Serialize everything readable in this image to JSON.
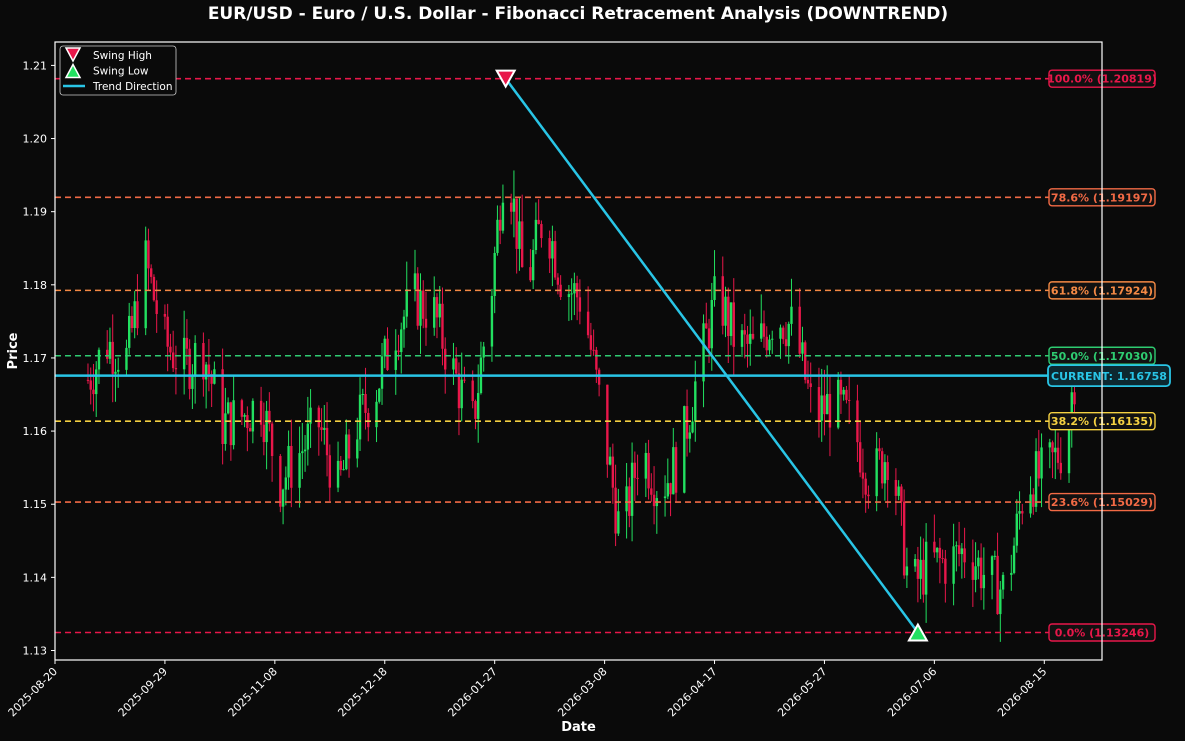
{
  "chart_data": {
    "type": "candlestick",
    "title": "EUR/USD - Euro / U.S. Dollar - Fibonacci Retracement Analysis (DOWNTREND)",
    "xlabel": "Date",
    "ylabel": "Price",
    "ylim": [
      1.1287,
      1.2132
    ],
    "xlim": [
      "2025-08-20",
      "2026-09-05"
    ],
    "x_ticks": [
      "2025-08-20",
      "2025-09-29",
      "2025-11-08",
      "2025-12-18",
      "2026-01-27",
      "2026-03-08",
      "2026-04-17",
      "2026-05-27",
      "2026-07-06",
      "2026-08-15"
    ],
    "y_ticks": [
      "1.13",
      "1.14",
      "1.15",
      "1.16",
      "1.17",
      "1.18",
      "1.19",
      "1.20",
      "1.21"
    ],
    "grid": false,
    "legend": {
      "placement": "top-left",
      "entries": [
        {
          "name": "Swing High",
          "marker": "down-triangle",
          "color": "#e8174a"
        },
        {
          "name": "Swing Low",
          "marker": "up-triangle",
          "color": "#22e060"
        },
        {
          "name": "Trend Direction",
          "marker": "line",
          "color": "#29c5e6"
        }
      ]
    },
    "fib_levels": [
      {
        "label": "100.0% (1.20819)",
        "price": 1.20819,
        "color": "#e8174a"
      },
      {
        "label": "78.6% (1.19197)",
        "price": 1.19197,
        "color": "#f26a45"
      },
      {
        "label": "61.8% (1.17924)",
        "price": 1.17924,
        "color": "#f58a45"
      },
      {
        "label": "50.0% (1.17030)",
        "price": 1.1703,
        "color": "#2ecc71"
      },
      {
        "label": "38.2% (1.16135)",
        "price": 1.16135,
        "color": "#f5d142"
      },
      {
        "label": "23.6% (1.15029)",
        "price": 1.15029,
        "color": "#f26a45"
      },
      {
        "label": "0.0% (1.13246)",
        "price": 1.13246,
        "color": "#e8174a"
      }
    ],
    "current": {
      "label": "CURRENT: 1.16758",
      "price": 1.16758,
      "color": "#29c5e6"
    },
    "swing_high": {
      "date": "2026-01-31",
      "price": 1.20819
    },
    "swing_low": {
      "date": "2026-06-30",
      "price": 1.13246
    },
    "trend_line": {
      "from": {
        "date": "2026-01-31",
        "price": 1.20819
      },
      "to": {
        "date": "2026-06-30",
        "price": 1.13246
      }
    },
    "candle_colors": {
      "up": "#22e060",
      "down": "#e8174a"
    },
    "price_path": [
      {
        "date": "2025-09-01",
        "price": 1.167
      },
      {
        "date": "2025-09-08",
        "price": 1.172
      },
      {
        "date": "2025-09-15",
        "price": 1.17
      },
      {
        "date": "2025-09-22",
        "price": 1.183
      },
      {
        "date": "2025-09-29",
        "price": 1.172
      },
      {
        "date": "2025-10-06",
        "price": 1.169
      },
      {
        "date": "2025-10-13",
        "price": 1.171
      },
      {
        "date": "2025-10-20",
        "price": 1.161
      },
      {
        "date": "2025-10-27",
        "price": 1.162
      },
      {
        "date": "2025-11-03",
        "price": 1.164
      },
      {
        "date": "2025-11-10",
        "price": 1.153
      },
      {
        "date": "2025-11-17",
        "price": 1.157
      },
      {
        "date": "2025-11-24",
        "price": 1.161
      },
      {
        "date": "2025-12-01",
        "price": 1.152
      },
      {
        "date": "2025-12-08",
        "price": 1.161
      },
      {
        "date": "2025-12-15",
        "price": 1.166
      },
      {
        "date": "2025-12-22",
        "price": 1.174
      },
      {
        "date": "2025-12-29",
        "price": 1.178
      },
      {
        "date": "2026-01-05",
        "price": 1.176
      },
      {
        "date": "2026-01-12",
        "price": 1.168
      },
      {
        "date": "2026-01-19",
        "price": 1.161
      },
      {
        "date": "2026-01-26",
        "price": 1.18
      },
      {
        "date": "2026-01-31",
        "price": 1.199
      },
      {
        "date": "2026-02-07",
        "price": 1.179
      },
      {
        "date": "2026-02-14",
        "price": 1.19
      },
      {
        "date": "2026-02-21",
        "price": 1.18
      },
      {
        "date": "2026-02-28",
        "price": 1.178
      },
      {
        "date": "2026-03-07",
        "price": 1.162
      },
      {
        "date": "2026-03-14",
        "price": 1.145
      },
      {
        "date": "2026-03-21",
        "price": 1.158
      },
      {
        "date": "2026-03-28",
        "price": 1.152
      },
      {
        "date": "2026-04-04",
        "price": 1.156
      },
      {
        "date": "2026-04-11",
        "price": 1.168
      },
      {
        "date": "2026-04-18",
        "price": 1.179
      },
      {
        "date": "2026-04-25",
        "price": 1.172
      },
      {
        "date": "2026-05-02",
        "price": 1.171
      },
      {
        "date": "2026-05-09",
        "price": 1.176
      },
      {
        "date": "2026-05-16",
        "price": 1.174
      },
      {
        "date": "2026-05-23",
        "price": 1.162
      },
      {
        "date": "2026-05-30",
        "price": 1.164
      },
      {
        "date": "2026-06-06",
        "price": 1.161
      },
      {
        "date": "2026-06-13",
        "price": 1.153
      },
      {
        "date": "2026-06-20",
        "price": 1.158
      },
      {
        "date": "2026-06-27",
        "price": 1.138
      },
      {
        "date": "2026-07-04",
        "price": 1.142
      },
      {
        "date": "2026-07-11",
        "price": 1.142
      },
      {
        "date": "2026-07-18",
        "price": 1.144
      },
      {
        "date": "2026-07-25",
        "price": 1.14
      },
      {
        "date": "2026-08-01",
        "price": 1.138
      },
      {
        "date": "2026-08-08",
        "price": 1.153
      },
      {
        "date": "2026-08-15",
        "price": 1.154
      },
      {
        "date": "2026-08-22",
        "price": 1.158
      },
      {
        "date": "2026-08-26",
        "price": 1.1676
      }
    ]
  }
}
